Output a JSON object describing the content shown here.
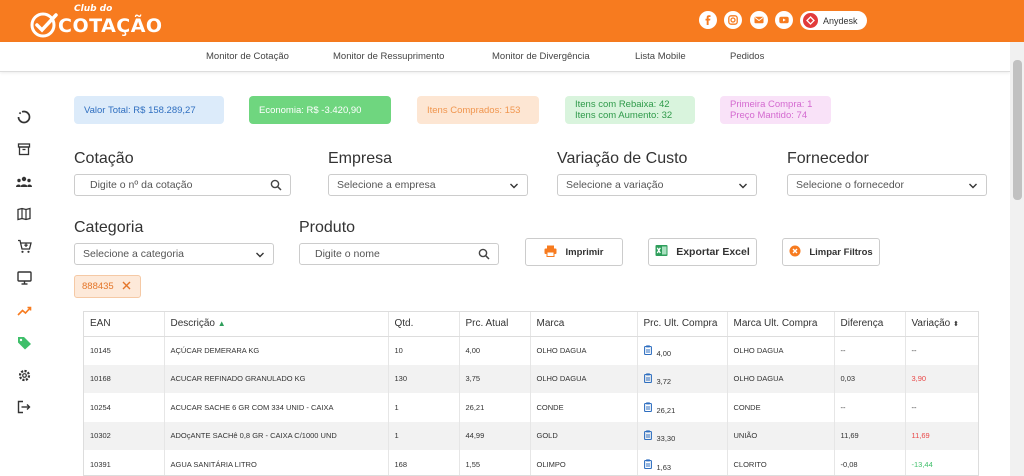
{
  "brand": {
    "small": "Club do",
    "big": "COTAÇÃO"
  },
  "header": {
    "social_icons": [
      "facebook-icon",
      "instagram-icon",
      "mail-icon",
      "youtube-icon"
    ],
    "anydesk_label": "Anydesk"
  },
  "nav": [
    "Monitor de Cotação",
    "Monitor de Ressuprimento",
    "Monitor de Divergência",
    "Lista Mobile",
    "Pedidos"
  ],
  "sidebar_icons": [
    "refresh-icon",
    "archive-icon",
    "users-icon",
    "map-icon",
    "cart-icon",
    "monitor-icon",
    "trending-up-icon",
    "tag-icon",
    "settings-icon",
    "logout-icon"
  ],
  "cards": {
    "total": "Valor Total: R$ 158.289,27",
    "economia": "Economia: R$ -3.420,90",
    "itens": "Itens Comprados: 153",
    "rebaixa": "Itens com Rebaixa: 42",
    "aumento": "Itens com Aumento: 32",
    "primeira": "Primeira Compra: 1",
    "mantido": "Preço Mantido: 74"
  },
  "filters": {
    "cotacao_label": "Cotação",
    "cotacao_placeholder": "Digite o nº da cotação",
    "empresa_label": "Empresa",
    "empresa_value": "Selecione a empresa",
    "variacao_label": "Variação de Custo",
    "variacao_value": "Selecione a variação",
    "fornecedor_label": "Fornecedor",
    "fornecedor_value": "Selecione o fornecedor",
    "categoria_label": "Categoria",
    "categoria_value": "Selecione a categoria",
    "produto_label": "Produto",
    "produto_placeholder": "Digite o nome"
  },
  "buttons": {
    "imprimir": "Imprimir",
    "excel": "Exportar Excel",
    "limpar": "Limpar Filtros"
  },
  "chip": "888435",
  "table": {
    "columns": [
      "EAN",
      "Descrição",
      "Qtd.",
      "Prc. Atual",
      "Marca",
      "Prc. Ult. Compra",
      "Marca Ult. Compra",
      "Diferença",
      "Variação"
    ],
    "rows": [
      [
        "10145",
        "AÇÚCAR DEMERARA KG",
        "10",
        "4,00",
        "OLHO DAGUA",
        "4,00",
        "OLHO DAGUA",
        "--",
        "--"
      ],
      [
        "10168",
        "ACUCAR REFINADO GRANULADO KG",
        "130",
        "3,75",
        "OLHO DAGUA",
        "3,72",
        "OLHO DAGUA",
        "0,03",
        "3,90"
      ],
      [
        "10254",
        "ACUCAR SACHE 6 GR COM 334 UNID - CAIXA",
        "1",
        "26,21",
        "CONDE",
        "26,21",
        "CONDE",
        "--",
        "--"
      ],
      [
        "10302",
        "ADOçANTE SACHê 0,8 GR - CAIXA C/1000 UND",
        "1",
        "44,99",
        "GOLD",
        "33,30",
        "UNIÃO",
        "11,69",
        "11,69"
      ],
      [
        "10391",
        "AGUA SANITÁRIA LITRO",
        "168",
        "1,55",
        "OLIMPO",
        "1,63",
        "CLORITO",
        "-0,08",
        "-13,44"
      ]
    ],
    "variation_colors": [
      "",
      "red",
      "",
      "red",
      "green"
    ]
  }
}
